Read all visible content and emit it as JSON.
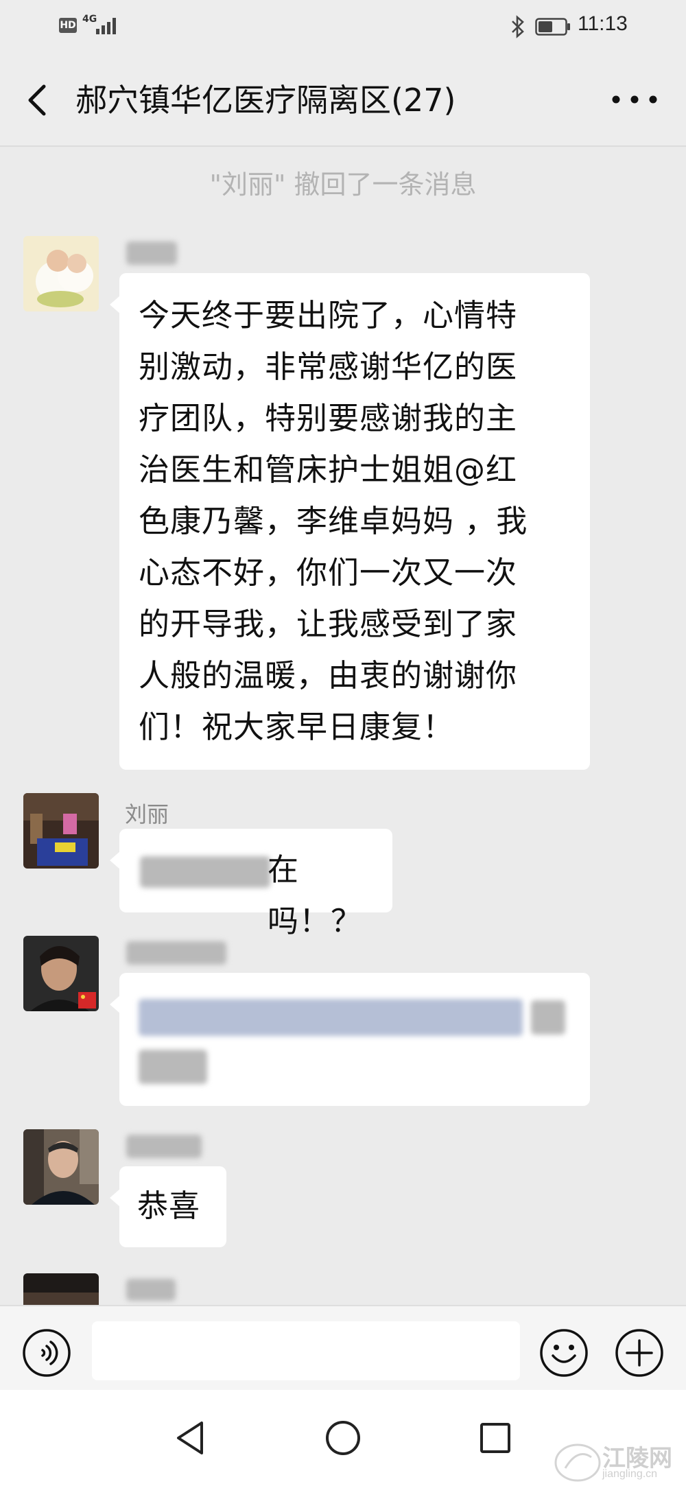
{
  "status_bar": {
    "hd": "HD",
    "network": "4G",
    "time": "11:13"
  },
  "header": {
    "title": "郝穴镇华亿医疗隔离区(27)"
  },
  "system_notice": "\"刘丽\" 撤回了一条消息",
  "messages": [
    {
      "sender": "",
      "text": "今天终于要出院了，心情特别激动，非常感谢华亿的医疗团队，特别要感谢我的主治医生和管床护士姐姐@红色康乃馨，李维卓妈妈 ，我心态不好，你们一次又一次的开导我，让我感受到了家人般的温暖，由衷的谢谢你们！祝大家早日康复！",
      "lines": [
        "今天终于要出院了，心情特",
        "别激动，非常感谢华亿的医",
        "疗团队，特别要感谢我的主",
        "治医生和管床护士姐姐@红",
        "色康乃馨，李维卓妈妈 ，我",
        "心态不好，你们一次又一次",
        "的开导我，让我感受到了家",
        "人般的温暖，由衷的谢谢你",
        "们！祝大家早日康复！"
      ]
    },
    {
      "sender": "刘丽",
      "text_visible": "在吗！？"
    },
    {
      "sender": "",
      "text_visible": ""
    },
    {
      "sender": "",
      "text": "恭喜"
    }
  ],
  "input": {
    "placeholder": ""
  },
  "icons": {
    "back": "chevron-left-icon",
    "more": "more-dots-icon",
    "voice": "voice-icon",
    "emoji": "emoji-icon",
    "plus": "plus-icon",
    "nav_back": "triangle-back-icon",
    "nav_home": "circle-home-icon",
    "nav_recent": "square-recent-icon"
  },
  "watermark": {
    "name": "江陵网",
    "domain": "jiangling.cn"
  }
}
